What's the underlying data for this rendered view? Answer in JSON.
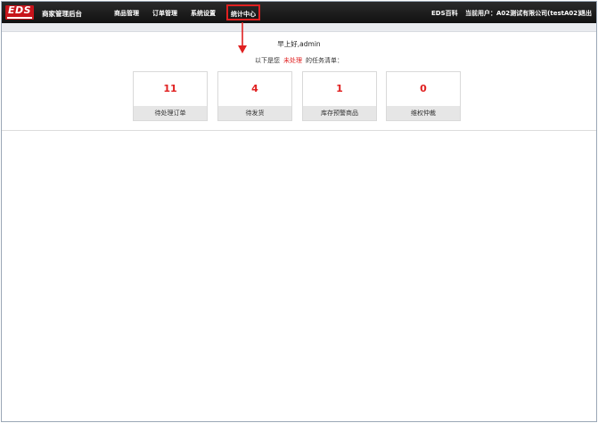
{
  "header": {
    "logo_text": "EDS",
    "brand_title": "商家管理后台",
    "nav": [
      {
        "label": "商品管理"
      },
      {
        "label": "订单管理"
      },
      {
        "label": "系统设置"
      },
      {
        "label": "统计中心",
        "active": true
      }
    ],
    "right": {
      "baike": "EDS百科",
      "current_user": "当前用户：A02测试有限公司(testA02)",
      "logout": "退出"
    }
  },
  "main": {
    "greeting": "早上好,admin",
    "tasks_prefix": "以下是您",
    "tasks_highlight": "未处理",
    "tasks_suffix": "的任务清单：",
    "cards": [
      {
        "value": "11",
        "label": "待处理订单"
      },
      {
        "value": "4",
        "label": "待发货"
      },
      {
        "value": "1",
        "label": "库存预警商品"
      },
      {
        "value": "0",
        "label": "维权仲裁"
      }
    ]
  },
  "colors": {
    "accent": "#e02020",
    "topbar": "#1a1a1a",
    "card_label_bg": "#e6e6e6"
  }
}
